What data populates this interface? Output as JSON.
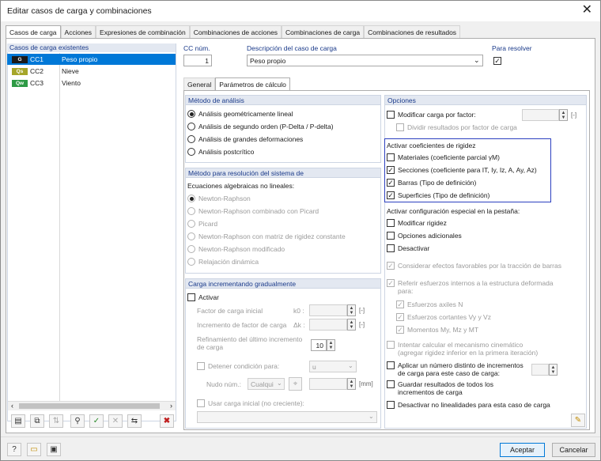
{
  "window": {
    "title": "Editar casos de carga y combinaciones",
    "close": "✕"
  },
  "tabs": [
    "Casos de carga",
    "Acciones",
    "Expresiones de combinación",
    "Combinaciones de acciones",
    "Combinaciones de carga",
    "Combinaciones de resultados"
  ],
  "load_cases": {
    "header": "Casos de carga existentes",
    "items": [
      {
        "tag": "G",
        "tag_color": "#1a1a1a",
        "code": "CC1",
        "name": "Peso propio",
        "selected": true
      },
      {
        "tag": "Qs",
        "tag_color": "#a6a62a",
        "code": "CC2",
        "name": "Nieve",
        "selected": false
      },
      {
        "tag": "Qw",
        "tag_color": "#2e9a45",
        "code": "CC3",
        "name": "Viento",
        "selected": false
      }
    ]
  },
  "cc_num": {
    "label": "CC núm.",
    "value": "1"
  },
  "description": {
    "label": "Descripción del caso de carga",
    "value": "Peso propio"
  },
  "solve": {
    "label": "Para resolver"
  },
  "subtabs": [
    "General",
    "Parámetros de cálculo"
  ],
  "analysis": {
    "header": "Método de análisis",
    "options": [
      "Análisis geométricamente lineal",
      "Análisis de segundo orden (P-Delta / P-delta)",
      "Análisis de grandes deformaciones",
      "Análisis postcrítico"
    ]
  },
  "resolution": {
    "header": "Método para resolución del sistema de",
    "sub": "Ecuaciones algebraicas no lineales:",
    "options": [
      "Newton-Raphson",
      "Newton-Raphson combinado con Picard",
      "Picard",
      "Newton-Raphson con matriz de rigidez constante",
      "Newton-Raphson modificado",
      "Relajación dinámica"
    ]
  },
  "incremental": {
    "header": "Carga incrementando gradualmente",
    "activate": "Activar",
    "initial_factor": "Factor de carga inicial",
    "k0": "k0 :",
    "increment": "Incremento de factor de carga",
    "dk": "Δk :",
    "refinement": "Refinamiento del último incremento de carga",
    "refinement_value": "10",
    "stop": "Detener condición para:",
    "stop_value": "u",
    "node": "Nudo núm.:",
    "node_value": "Cualqui",
    "unit_bracket": "[-]",
    "unit_mm": "[mm]",
    "use_initial": "Usar carga inicial (no creciente):"
  },
  "options": {
    "header": "Opciones",
    "modify_factor": "Modificar carga por factor:",
    "divide": "Dividir resultados por factor de carga",
    "rigidity_header": "Activar coeficientes de rigidez",
    "rigidity": [
      "Materiales (coeficiente parcial γM)",
      "Secciones (coeficiente para IT, Iy, Iz, A, Ay, Az)",
      "Barras (Tipo de definición)",
      "Superficies (Tipo de definición)"
    ],
    "special_header": "Activar configuración especial en la pestaña:",
    "special": [
      "Modificar rigidez",
      "Opciones adicionales",
      "Desactivar"
    ],
    "favorable": "Considerar efectos favorables por la tracción de barras",
    "refer": "Referir esfuerzos internos a la estructura deformada para:",
    "refer_items": [
      "Esfuerzos axiles N",
      "Esfuerzos cortantes Vy y Vz",
      "Momentos My, Mz y MT"
    ],
    "kinematic": "Intentar calcular el mecanismo cinemático (agregar rigidez inferior en la primera iteración)",
    "apply_increments": "Aplicar un número distinto de incrementos de carga para este caso de carga:",
    "save_results": "Guardar resultados de todos los incrementos de carga",
    "deactivate_nonlinear": "Desactivar no linealidades para esta caso de carga"
  },
  "footer": {
    "accept": "Aceptar",
    "cancel": "Cancelar"
  }
}
